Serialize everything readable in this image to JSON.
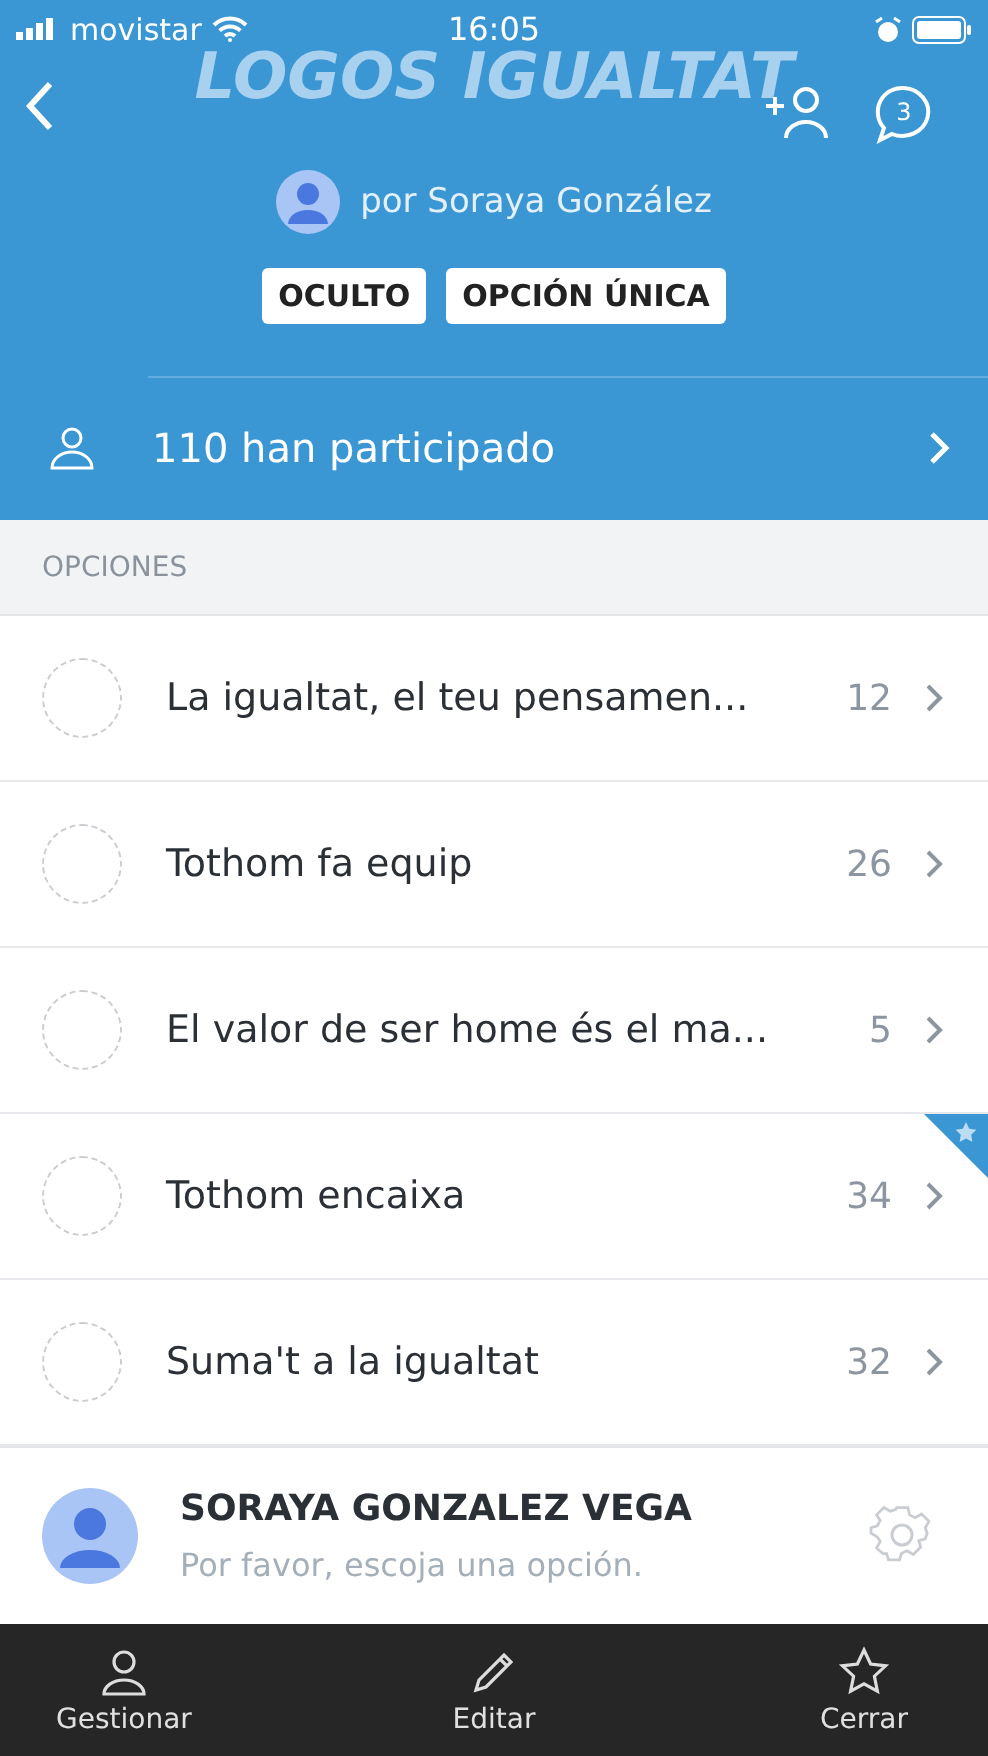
{
  "status_bar": {
    "carrier": "movistar",
    "time": "16:05"
  },
  "header": {
    "title": "LOGOS IGUALTAT",
    "chat_count": "3",
    "author": "por Soraya González",
    "tags": [
      "OCULTO",
      "OPCIÓN ÚNICA"
    ],
    "participants": "110 han participado"
  },
  "options_heading": "OPCIONES",
  "options": [
    {
      "label": "La igualtat, el teu pensamen...",
      "count": "12",
      "selected": false,
      "starred": false
    },
    {
      "label": "Tothom fa equip",
      "count": "26",
      "selected": false,
      "starred": false
    },
    {
      "label": "El valor de ser home és el ma...",
      "count": "5",
      "selected": false,
      "starred": false
    },
    {
      "label": "Tothom encaixa",
      "count": "34",
      "selected": false,
      "starred": true
    },
    {
      "label": "Suma't a la igualtat",
      "count": "32",
      "selected": false,
      "starred": false
    }
  ],
  "user": {
    "name": "SORAYA GONZALEZ VEGA",
    "hint": "Por favor, escoja una opción."
  },
  "toolbar": [
    {
      "kind": "person",
      "label": "Gestionar"
    },
    {
      "kind": "pencil",
      "label": "Editar"
    },
    {
      "kind": "star",
      "label": "Cerrar"
    }
  ]
}
